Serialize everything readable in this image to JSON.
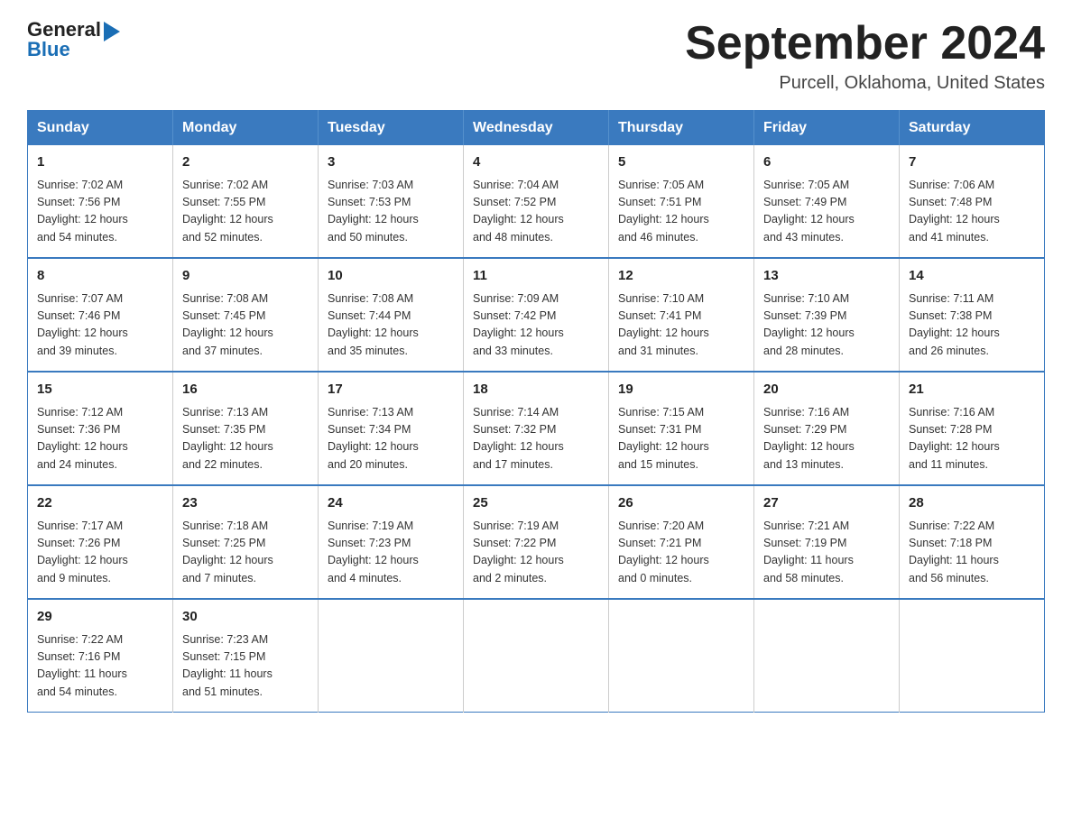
{
  "logo": {
    "general": "General",
    "blue": "Blue",
    "triangle": "▶"
  },
  "title": {
    "month_year": "September 2024",
    "location": "Purcell, Oklahoma, United States"
  },
  "weekdays": [
    "Sunday",
    "Monday",
    "Tuesday",
    "Wednesday",
    "Thursday",
    "Friday",
    "Saturday"
  ],
  "weeks": [
    [
      {
        "day": "1",
        "sunrise": "7:02 AM",
        "sunset": "7:56 PM",
        "daylight": "12 hours and 54 minutes."
      },
      {
        "day": "2",
        "sunrise": "7:02 AM",
        "sunset": "7:55 PM",
        "daylight": "12 hours and 52 minutes."
      },
      {
        "day": "3",
        "sunrise": "7:03 AM",
        "sunset": "7:53 PM",
        "daylight": "12 hours and 50 minutes."
      },
      {
        "day": "4",
        "sunrise": "7:04 AM",
        "sunset": "7:52 PM",
        "daylight": "12 hours and 48 minutes."
      },
      {
        "day": "5",
        "sunrise": "7:05 AM",
        "sunset": "7:51 PM",
        "daylight": "12 hours and 46 minutes."
      },
      {
        "day": "6",
        "sunrise": "7:05 AM",
        "sunset": "7:49 PM",
        "daylight": "12 hours and 43 minutes."
      },
      {
        "day": "7",
        "sunrise": "7:06 AM",
        "sunset": "7:48 PM",
        "daylight": "12 hours and 41 minutes."
      }
    ],
    [
      {
        "day": "8",
        "sunrise": "7:07 AM",
        "sunset": "7:46 PM",
        "daylight": "12 hours and 39 minutes."
      },
      {
        "day": "9",
        "sunrise": "7:08 AM",
        "sunset": "7:45 PM",
        "daylight": "12 hours and 37 minutes."
      },
      {
        "day": "10",
        "sunrise": "7:08 AM",
        "sunset": "7:44 PM",
        "daylight": "12 hours and 35 minutes."
      },
      {
        "day": "11",
        "sunrise": "7:09 AM",
        "sunset": "7:42 PM",
        "daylight": "12 hours and 33 minutes."
      },
      {
        "day": "12",
        "sunrise": "7:10 AM",
        "sunset": "7:41 PM",
        "daylight": "12 hours and 31 minutes."
      },
      {
        "day": "13",
        "sunrise": "7:10 AM",
        "sunset": "7:39 PM",
        "daylight": "12 hours and 28 minutes."
      },
      {
        "day": "14",
        "sunrise": "7:11 AM",
        "sunset": "7:38 PM",
        "daylight": "12 hours and 26 minutes."
      }
    ],
    [
      {
        "day": "15",
        "sunrise": "7:12 AM",
        "sunset": "7:36 PM",
        "daylight": "12 hours and 24 minutes."
      },
      {
        "day": "16",
        "sunrise": "7:13 AM",
        "sunset": "7:35 PM",
        "daylight": "12 hours and 22 minutes."
      },
      {
        "day": "17",
        "sunrise": "7:13 AM",
        "sunset": "7:34 PM",
        "daylight": "12 hours and 20 minutes."
      },
      {
        "day": "18",
        "sunrise": "7:14 AM",
        "sunset": "7:32 PM",
        "daylight": "12 hours and 17 minutes."
      },
      {
        "day": "19",
        "sunrise": "7:15 AM",
        "sunset": "7:31 PM",
        "daylight": "12 hours and 15 minutes."
      },
      {
        "day": "20",
        "sunrise": "7:16 AM",
        "sunset": "7:29 PM",
        "daylight": "12 hours and 13 minutes."
      },
      {
        "day": "21",
        "sunrise": "7:16 AM",
        "sunset": "7:28 PM",
        "daylight": "12 hours and 11 minutes."
      }
    ],
    [
      {
        "day": "22",
        "sunrise": "7:17 AM",
        "sunset": "7:26 PM",
        "daylight": "12 hours and 9 minutes."
      },
      {
        "day": "23",
        "sunrise": "7:18 AM",
        "sunset": "7:25 PM",
        "daylight": "12 hours and 7 minutes."
      },
      {
        "day": "24",
        "sunrise": "7:19 AM",
        "sunset": "7:23 PM",
        "daylight": "12 hours and 4 minutes."
      },
      {
        "day": "25",
        "sunrise": "7:19 AM",
        "sunset": "7:22 PM",
        "daylight": "12 hours and 2 minutes."
      },
      {
        "day": "26",
        "sunrise": "7:20 AM",
        "sunset": "7:21 PM",
        "daylight": "12 hours and 0 minutes."
      },
      {
        "day": "27",
        "sunrise": "7:21 AM",
        "sunset": "7:19 PM",
        "daylight": "11 hours and 58 minutes."
      },
      {
        "day": "28",
        "sunrise": "7:22 AM",
        "sunset": "7:18 PM",
        "daylight": "11 hours and 56 minutes."
      }
    ],
    [
      {
        "day": "29",
        "sunrise": "7:22 AM",
        "sunset": "7:16 PM",
        "daylight": "11 hours and 54 minutes."
      },
      {
        "day": "30",
        "sunrise": "7:23 AM",
        "sunset": "7:15 PM",
        "daylight": "11 hours and 51 minutes."
      },
      null,
      null,
      null,
      null,
      null
    ]
  ],
  "labels": {
    "sunrise": "Sunrise:",
    "sunset": "Sunset:",
    "daylight": "Daylight:"
  }
}
